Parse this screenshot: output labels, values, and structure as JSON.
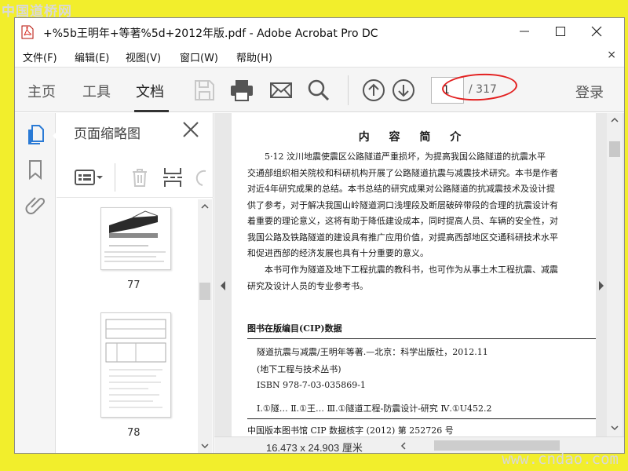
{
  "watermark": {
    "top": "中国道桥网",
    "bottom": "www.cndao.com"
  },
  "window": {
    "title": "+%5b王明年+等著%5d+2012年版.pdf - Adobe Acrobat Pro DC"
  },
  "menu": {
    "items": [
      "文件(F)",
      "编辑(E)",
      "视图(V)",
      "窗口(W)",
      "帮助(H)"
    ],
    "close_glyph": "×"
  },
  "toolbar": {
    "tabs": [
      "主页",
      "工具",
      "文档"
    ],
    "active_tab": "文档",
    "current_page": "1",
    "total_pages": "/ 317",
    "login": "登录",
    "accent_color": "#e32020"
  },
  "panel": {
    "title": "页面缩略图",
    "thumbnails": [
      {
        "label": "77"
      },
      {
        "label": "78"
      }
    ]
  },
  "document": {
    "heading": "内 容 简 介",
    "paragraphs": [
      "5·12 汶川地震使震区公路隧道严重损坏，为提高我国公路隧道的抗震水平",
      "交通部组织相关院校和科研机构开展了公路隧道抗震与减震技术研究。本书是作者",
      "对近4年研究成果的总结。本书总结的研究成果对公路隧道的抗减震技术及设计提",
      "供了参考，对于解决我国山岭隧道洞口浅埋段及断层破碎带段的合理的抗震设计有",
      "着重要的理论意义，这将有助于降低建设成本，同时提高人员、车辆的安全性，对",
      "我国公路及铁路隧道的建设具有推广应用价值，对提高西部地区交通科研技术水平",
      "和促进西部的经济发展也具有十分重要的意义。"
    ],
    "paragraph2": [
      "本书可作为隧道及地下工程抗震的教科书，也可作为从事土木工程抗震、减震",
      "研究及设计人员的专业参考书。"
    ],
    "cip": {
      "title": "图书在版编目(CIP)数据",
      "lines": [
        "隧道抗震与减震/王明年等著.—北京：科学出版社，2012.11",
        "(地下工程与技术丛书)",
        "ISBN 978-7-03-035869-1",
        "Ⅰ.①隧…  Ⅱ.①王…  Ⅲ.①隧道工程-防震设计-研究  Ⅳ.①U452.2"
      ],
      "footer": "中国版本图书馆 CIP 数据核字 (2012) 第 252726 号"
    },
    "page_size": "16.473 x 24.903 厘米"
  }
}
